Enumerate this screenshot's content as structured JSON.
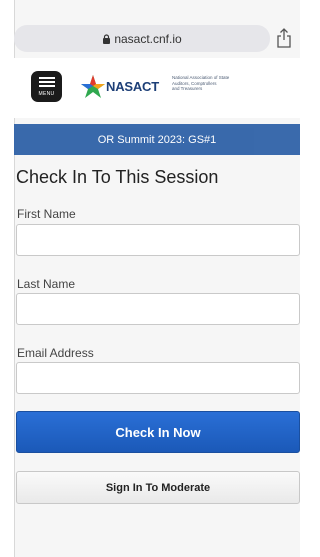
{
  "browser": {
    "url": "nasact.cnf.io"
  },
  "header": {
    "menu_label": "MENU",
    "logo_text": "NASACT",
    "logo_subtitle": "National Association of State\nAuditors, Comptrollers\nand Treasurers"
  },
  "banner": {
    "session": "OR Summit 2023: GS#1"
  },
  "form": {
    "title": "Check In To This Session",
    "first_name_label": "First Name",
    "first_name_value": "",
    "last_name_label": "Last Name",
    "last_name_value": "",
    "email_label": "Email Address",
    "email_value": "",
    "check_in_label": "Check In Now",
    "moderate_label": "Sign In To Moderate"
  },
  "colors": {
    "banner": "#2f62a8",
    "primary_button": "#1b59b8",
    "logo_navy": "#1d3f77"
  }
}
